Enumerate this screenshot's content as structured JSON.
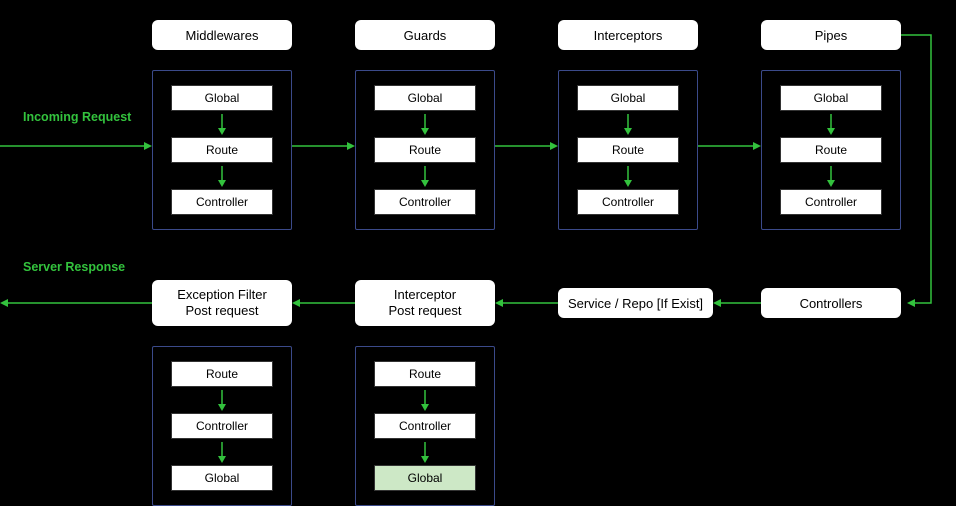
{
  "labels": {
    "incoming": "Incoming Request",
    "response": "Server Response"
  },
  "topHeaders": {
    "middlewares": "Middlewares",
    "guards": "Guards",
    "interceptors": "Interceptors",
    "pipes": "Pipes"
  },
  "topBoxes": {
    "global": "Global",
    "route": "Route",
    "controller": "Controller"
  },
  "bottomHeaders": {
    "exceptionFilter_l1": "Exception Filter",
    "exceptionFilter_l2": "Post request",
    "interceptorPost_l1": "Interceptor",
    "interceptorPost_l2": "Post request",
    "serviceRepo": "Service / Repo [If Exist]",
    "controllers": "Controllers"
  },
  "bottomBoxes": {
    "route": "Route",
    "controller": "Controller",
    "global": "Global"
  },
  "chart_data": {
    "type": "diagram",
    "title": "Request lifecycle pipeline",
    "flow_in": [
      "Incoming Request",
      "Middlewares",
      "Guards",
      "Interceptors",
      "Pipes",
      "Controllers",
      "Service / Repo [If Exist]"
    ],
    "flow_out": [
      "Interceptor Post request",
      "Exception Filter Post request",
      "Server Response"
    ],
    "stage_execution_order_incoming": [
      "Global",
      "Route",
      "Controller"
    ],
    "stage_execution_order_outgoing": [
      "Route",
      "Controller",
      "Global"
    ],
    "stages_with_levels": [
      "Middlewares",
      "Guards",
      "Interceptors",
      "Pipes",
      "Interceptor Post request",
      "Exception Filter Post request"
    ]
  }
}
